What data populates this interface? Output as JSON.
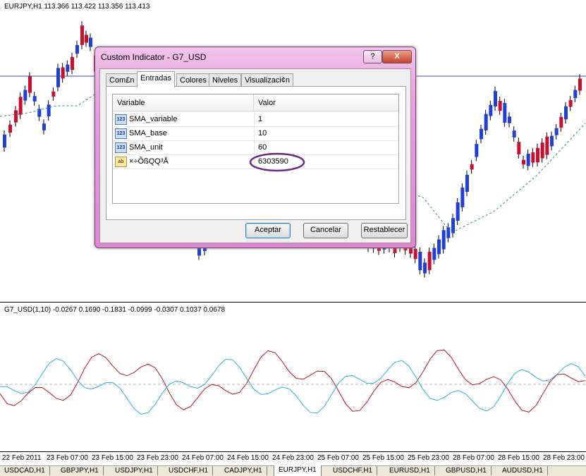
{
  "main_chart": {
    "header": "EURJPY,H1  113.366 113.422 113.356 113.413"
  },
  "sub_chart": {
    "header": "G7_USD(1,10) -0.0267 0.1690 -0.1831 -0.0999 -0.0307 0.1037 0.0678"
  },
  "time_axis": [
    "22 Feb 2011",
    "23 Feb 07:00",
    "23 Feb 15:00",
    "23 Feb 23:00",
    "24 Feb 07:00",
    "24 Feb 15:00",
    "24 Feb 23:00",
    "25 Feb 07:00",
    "25 Feb 15:00",
    "25 Feb 23:00",
    "28 Feb 07:00",
    "28 Feb 15:00",
    "28 Feb 23:00"
  ],
  "symbol_tabs": [
    "USDCAD,H1",
    "GBPJPY,H1",
    "USDJPY,H1",
    "USDCHF,H1",
    "CADJPY,H1",
    "EURJPY,H1",
    "USDCHF,H1",
    "EURUSD,H1",
    "GBPUSD,H1",
    "AUDUSD,H1"
  ],
  "active_symbol_tab": "EURJPY,H1",
  "dialog": {
    "title": "Custom Indicator - G7_USD",
    "help_label": "?",
    "close_label": "X",
    "tabs": [
      "Com£n",
      "Entradas",
      "Colores",
      "Niveles",
      "Visualizaci¢n"
    ],
    "active_tab": "Entradas",
    "columns": {
      "variable": "Variable",
      "value": "Valor"
    },
    "rows": [
      {
        "icon": "number-icon",
        "icon_text": "123",
        "name": "SMA_variable",
        "value": "1"
      },
      {
        "icon": "number-icon",
        "icon_text": "123",
        "name": "SMA_base",
        "value": "10"
      },
      {
        "icon": "number-icon",
        "icon_text": "123",
        "name": "SMA_unit",
        "value": "60"
      },
      {
        "icon": "string-icon",
        "icon_text": "ab",
        "name": "×÷ÕßQQ³Å",
        "value": "6303590"
      }
    ],
    "buttons": {
      "ok": "Aceptar",
      "cancel": "Cancelar",
      "reset": "Restablecer"
    }
  },
  "colors": {
    "bull": "#1f3fd6",
    "bear": "#c8102e",
    "line_red": "#c0141c",
    "line_blue": "#2ab0e6",
    "highlight": "#6a2a8c"
  }
}
